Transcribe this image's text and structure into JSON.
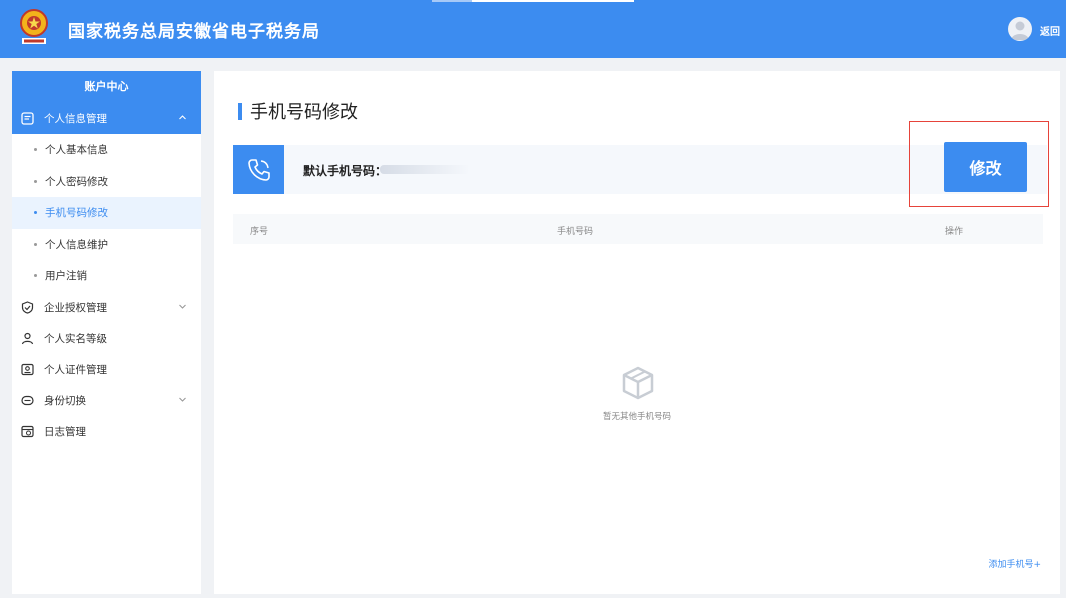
{
  "header": {
    "title": "国家税务总局安徽省电子税务局",
    "back_label": "返回"
  },
  "sidebar": {
    "heading": "账户中心",
    "groups": [
      {
        "label": "个人信息管理",
        "icon": "form-icon",
        "expanded": true
      },
      {
        "label": "企业授权管理",
        "icon": "shield-check-icon"
      },
      {
        "label": "个人实名等级",
        "icon": "user-hand-icon"
      },
      {
        "label": "个人证件管理",
        "icon": "id-card-icon"
      },
      {
        "label": "身份切换",
        "icon": "switch-icon"
      },
      {
        "label": "日志管理",
        "icon": "log-icon"
      }
    ],
    "subitems": [
      {
        "label": "个人基本信息"
      },
      {
        "label": "个人密码修改"
      },
      {
        "label": "手机号码修改",
        "active": true
      },
      {
        "label": "个人信息维护"
      },
      {
        "label": "用户注销"
      }
    ]
  },
  "main": {
    "page_title": "手机号码修改",
    "default_phone_label": "默认手机号码：",
    "modify_button": "修改",
    "table": {
      "columns": [
        "序号",
        "手机号码",
        "操作"
      ]
    },
    "empty_text": "暂无其他手机号码",
    "add_link": "添加手机号+"
  },
  "colors": {
    "primary": "#3c8cf0",
    "highlight_box": "#e6433a"
  }
}
